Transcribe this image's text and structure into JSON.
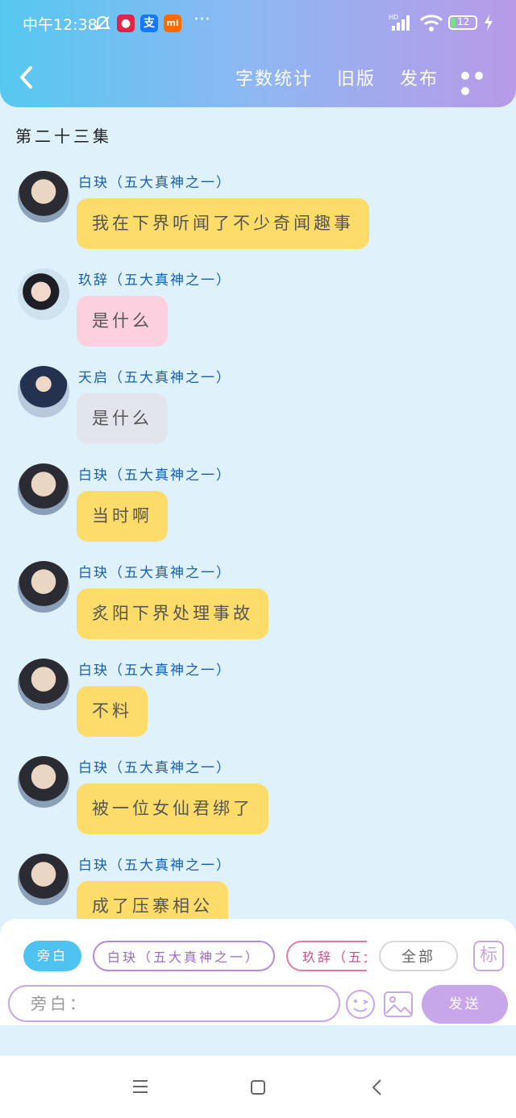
{
  "status_bar": {
    "time": "中午12:38",
    "dots": "···",
    "battery": "12"
  },
  "header": {
    "word_count": "字数统计",
    "old_version": "旧版",
    "publish": "发布"
  },
  "episode_title": "第二十三集",
  "messages": [
    {
      "name": "白玦（五大真神之一）",
      "text": "我在下界听闻了不少奇闻趣事",
      "color": "yellow"
    },
    {
      "name": "玖辞（五大真神之一）",
      "text": "是什么",
      "color": "pink"
    },
    {
      "name": "天启（五大真神之一）",
      "text": "是什么",
      "color": "grey"
    },
    {
      "name": "白玦（五大真神之一）",
      "text": "当时啊",
      "color": "yellow"
    },
    {
      "name": "白玦（五大真神之一）",
      "text": "炙阳下界处理事故",
      "color": "yellow"
    },
    {
      "name": "白玦（五大真神之一）",
      "text": "不料",
      "color": "yellow"
    },
    {
      "name": "白玦（五大真神之一）",
      "text": "被一位女仙君绑了",
      "color": "yellow"
    },
    {
      "name": "白玦（五大真神之一）",
      "text": "成了压寨相公",
      "color": "yellow"
    }
  ],
  "composer": {
    "chips": [
      "旁白",
      "白玦（五大真神之一）",
      "玖辞（五大真神之一）",
      "全部"
    ],
    "mark_label": "标",
    "input_placeholder": "旁白：",
    "send_label": "发送"
  },
  "colors": {
    "accent": "#c7a6ea",
    "narration_chip": "#4ec3ef",
    "name_text": "#1b5fae"
  }
}
